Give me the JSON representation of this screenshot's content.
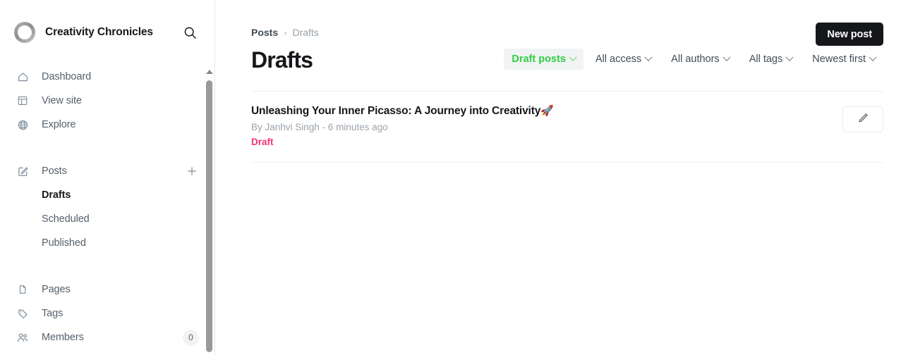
{
  "sidebar": {
    "brand": {
      "name": "Creativity Chronicles",
      "logo_icon": "circle-ring-logo",
      "search_icon": "search-icon"
    },
    "nav_primary": [
      {
        "label": "Dashboard",
        "icon": "home-icon"
      },
      {
        "label": "View site",
        "icon": "layout-icon"
      },
      {
        "label": "Explore",
        "icon": "globe-icon"
      }
    ],
    "posts": {
      "label": "Posts",
      "icon": "pencil-square-icon",
      "add_icon": "plus-icon",
      "children": [
        {
          "label": "Drafts",
          "active": true
        },
        {
          "label": "Scheduled",
          "active": false
        },
        {
          "label": "Published",
          "active": false
        }
      ]
    },
    "nav_secondary": [
      {
        "label": "Pages",
        "icon": "pages-icon",
        "badge": ""
      },
      {
        "label": "Tags",
        "icon": "tag-icon",
        "badge": ""
      },
      {
        "label": "Members",
        "icon": "members-icon",
        "badge": "0"
      }
    ],
    "scrollbar": {
      "arrow_icon": "caret-up-icon"
    }
  },
  "main": {
    "breadcrumb": {
      "root": "Posts",
      "separator": "›",
      "current": "Drafts"
    },
    "page_title": "Drafts",
    "new_post_label": "New post",
    "filters": [
      {
        "label": "Draft posts",
        "active": true
      },
      {
        "label": "All access",
        "active": false
      },
      {
        "label": "All authors",
        "active": false
      },
      {
        "label": "All tags",
        "active": false
      },
      {
        "label": "Newest first",
        "active": false
      }
    ],
    "posts": [
      {
        "title": "Unleashing Your Inner Picasso: A Journey into Creativity",
        "emoji": "🚀",
        "meta": "By Janhvi Singh - 6 minutes ago",
        "status": "Draft",
        "edit_icon": "pencil-icon"
      }
    ]
  },
  "colors": {
    "accent_green": "#30cf43",
    "status_draft_pink": "#f5326f",
    "dark": "#15171a",
    "muted": "#9aa3ab"
  }
}
